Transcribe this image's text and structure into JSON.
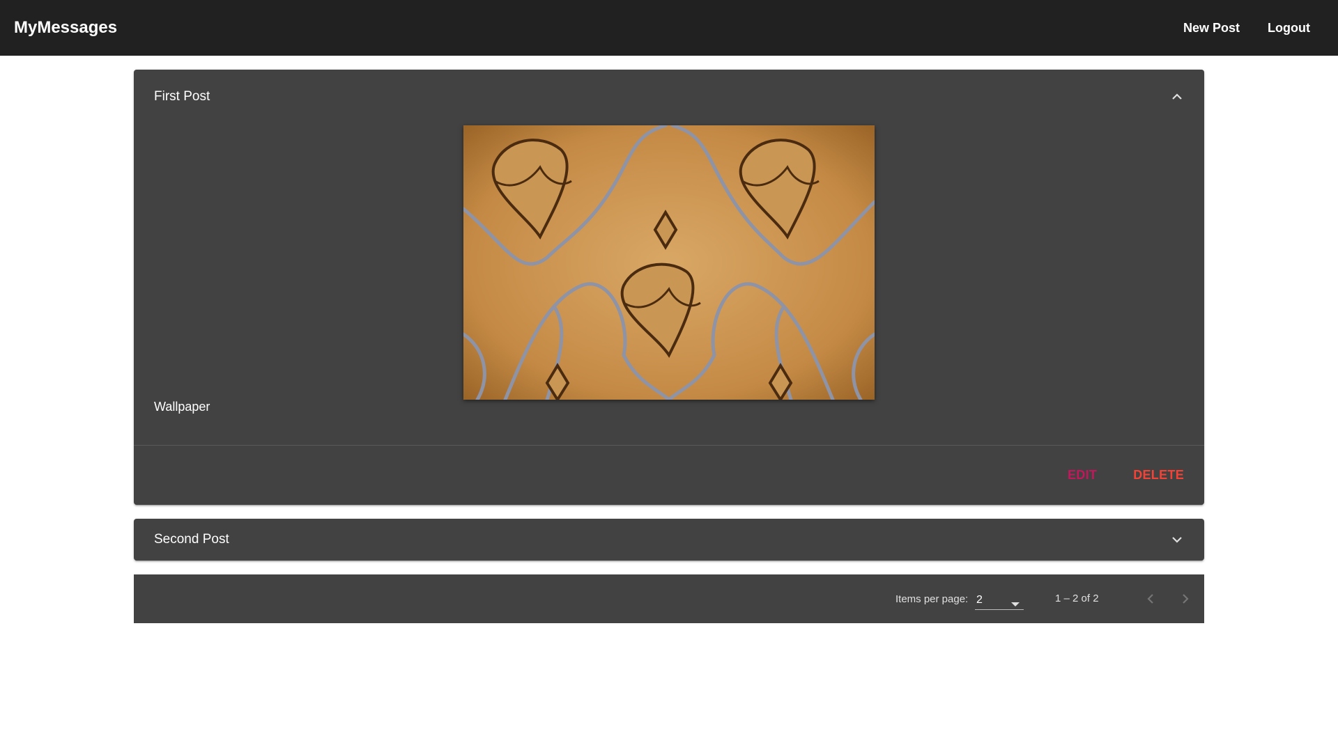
{
  "toolbar": {
    "title": "MyMessages",
    "new_post_label": "New Post",
    "logout_label": "Logout"
  },
  "posts": [
    {
      "title": "First Post",
      "content": "Wallpaper",
      "expanded": true,
      "edit_label": "EDIT",
      "delete_label": "DELETE",
      "expand_icon": "chevron-up-icon"
    },
    {
      "title": "Second Post",
      "expanded": false,
      "expand_icon": "chevron-down-icon"
    }
  ],
  "paginator": {
    "items_per_page_label": "Items per page:",
    "page_size": "2",
    "range_label": "1 – 2 of 2",
    "prev_icon": "chevron-left-icon",
    "next_icon": "chevron-right-icon"
  },
  "colors": {
    "toolbar_bg": "#212121",
    "panel_bg": "#424242",
    "edit": "#c2185b",
    "delete": "#f44336"
  }
}
